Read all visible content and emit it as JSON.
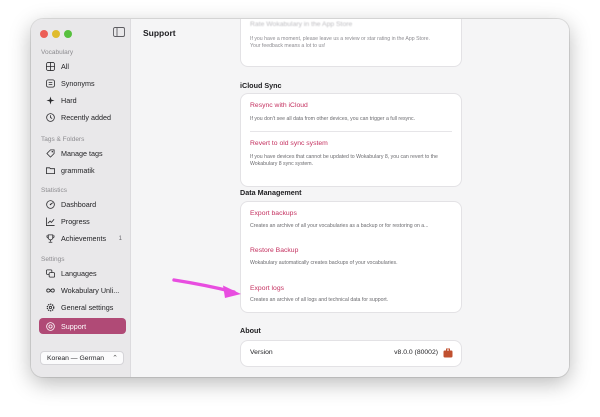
{
  "window": {
    "title": "Support"
  },
  "sidebar": {
    "sections": [
      {
        "label": "Vocabulary",
        "items": [
          {
            "label": "All",
            "icon": "grid-icon"
          },
          {
            "label": "Synonyms",
            "icon": "equals-icon"
          },
          {
            "label": "Hard",
            "icon": "sparkle-icon"
          },
          {
            "label": "Recently added",
            "icon": "clock-icon"
          }
        ]
      },
      {
        "label": "Tags & Folders",
        "items": [
          {
            "label": "Manage tags",
            "icon": "tag-icon"
          },
          {
            "label": "grammatik",
            "icon": "folder-icon"
          }
        ]
      },
      {
        "label": "Statistics",
        "items": [
          {
            "label": "Dashboard",
            "icon": "dashboard-icon"
          },
          {
            "label": "Progress",
            "icon": "chart-icon"
          },
          {
            "label": "Achievements",
            "icon": "trophy-icon",
            "badge": "1"
          }
        ]
      },
      {
        "label": "Settings",
        "items": [
          {
            "label": "Languages",
            "icon": "languages-icon"
          },
          {
            "label": "Wokabulary Unli...",
            "icon": "infinity-icon"
          },
          {
            "label": "General settings",
            "icon": "gear-icon"
          },
          {
            "label": "Support",
            "icon": "support-icon",
            "active": true
          }
        ]
      }
    ],
    "language_select": {
      "value": "Korean — German"
    }
  },
  "main": {
    "top_card": {
      "title": "Rate Wokabulary in the App Store",
      "desc_1": "If you have a moment, please leave us a review or star rating in the App Store.",
      "desc_2": "Your feedback means a lot to us!"
    },
    "icloud": {
      "heading": "iCloud Sync",
      "rows": [
        {
          "title": "Resync with iCloud",
          "desc": "If you don't see all data from other devices, you can trigger a full resync."
        },
        {
          "title": "Revert to old sync system",
          "desc": "If you have devices that cannot be updated to Wokabulary 8, you can revert to the Wokabulary 8 sync system."
        }
      ]
    },
    "data_management": {
      "heading": "Data Management",
      "rows": [
        {
          "title": "Export backups",
          "desc": "Creates an archive of all your vocabularies as a backup or for restoring on a..."
        },
        {
          "title": "Restore Backup",
          "desc": "Wokabulary automatically creates backups of your vocabularies."
        },
        {
          "title": "Export logs",
          "desc": "Creates an archive of all logs and technical data for support."
        }
      ]
    },
    "about": {
      "heading": "About",
      "version_label": "Version",
      "version_value": "v8.0.0 (80002)"
    }
  },
  "colors": {
    "accent": "#c4305f",
    "active_bg": "#b04a76",
    "annotation": "#e84de0"
  }
}
